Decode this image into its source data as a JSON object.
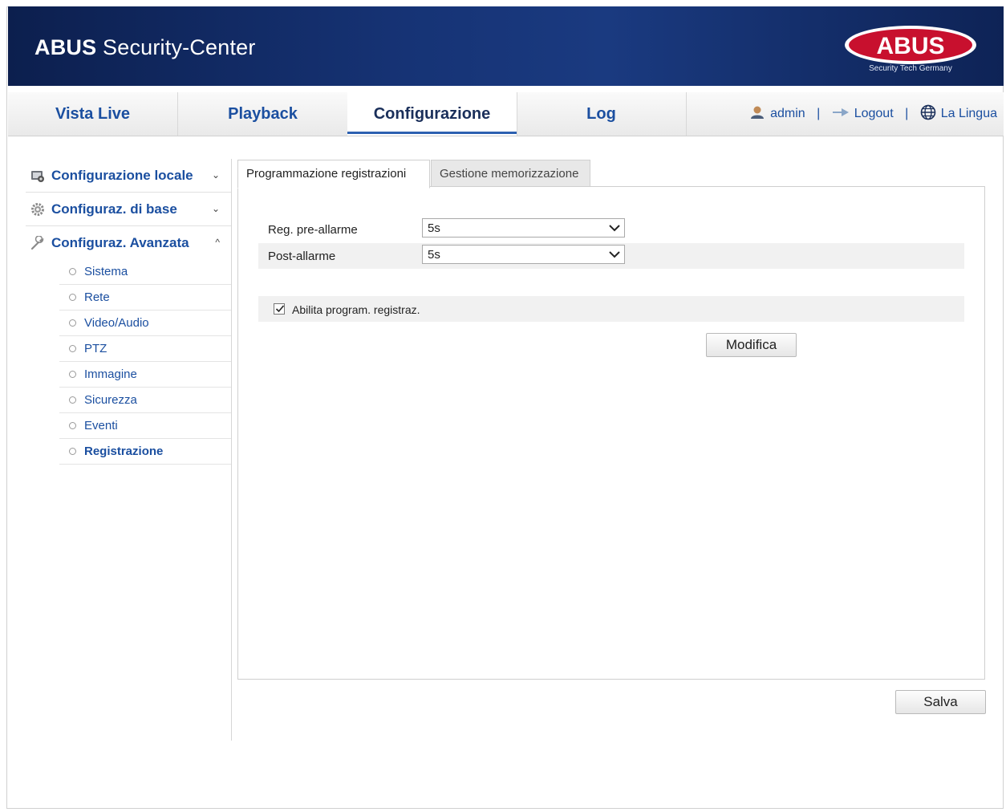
{
  "header": {
    "brand": "ABUS",
    "title_rest": " Security-Center",
    "logo_text": "ABUS",
    "logo_tagline": "Security Tech Germany"
  },
  "nav": {
    "tabs": [
      {
        "label": "Vista Live"
      },
      {
        "label": "Playback"
      },
      {
        "label": "Configurazione",
        "active": true
      },
      {
        "label": "Log"
      }
    ],
    "user": "admin",
    "separator": "|",
    "logout": "Logout",
    "language": "La Lingua"
  },
  "sidebar": {
    "groups": [
      {
        "label": "Configurazione locale",
        "chevron": "⌄",
        "icon": "local-config-icon"
      },
      {
        "label": "Configuraz. di base",
        "chevron": "⌄",
        "icon": "gear-icon"
      },
      {
        "label": "Configuraz. Avanzata",
        "chevron": "^",
        "icon": "wrench-icon"
      }
    ],
    "items": [
      {
        "label": "Sistema"
      },
      {
        "label": "Rete"
      },
      {
        "label": "Video/Audio"
      },
      {
        "label": "PTZ"
      },
      {
        "label": "Immagine"
      },
      {
        "label": "Sicurezza"
      },
      {
        "label": "Eventi"
      },
      {
        "label": "Registrazione",
        "active": true
      }
    ]
  },
  "content": {
    "tabs": [
      {
        "label": "Programmazione registrazioni",
        "active": true
      },
      {
        "label": "Gestione memorizzazione"
      }
    ],
    "fields": [
      {
        "label": "Reg. pre-allarme",
        "value": "5s"
      },
      {
        "label": "Post-allarme",
        "value": "5s"
      }
    ],
    "checkbox": {
      "label": "Abilita program. registraz.",
      "checked": true
    },
    "modify_button": "Modifica",
    "save_button": "Salva"
  },
  "colors": {
    "header_bg": "#163375",
    "link": "#1b4fa0",
    "logo_red": "#c8102e"
  }
}
